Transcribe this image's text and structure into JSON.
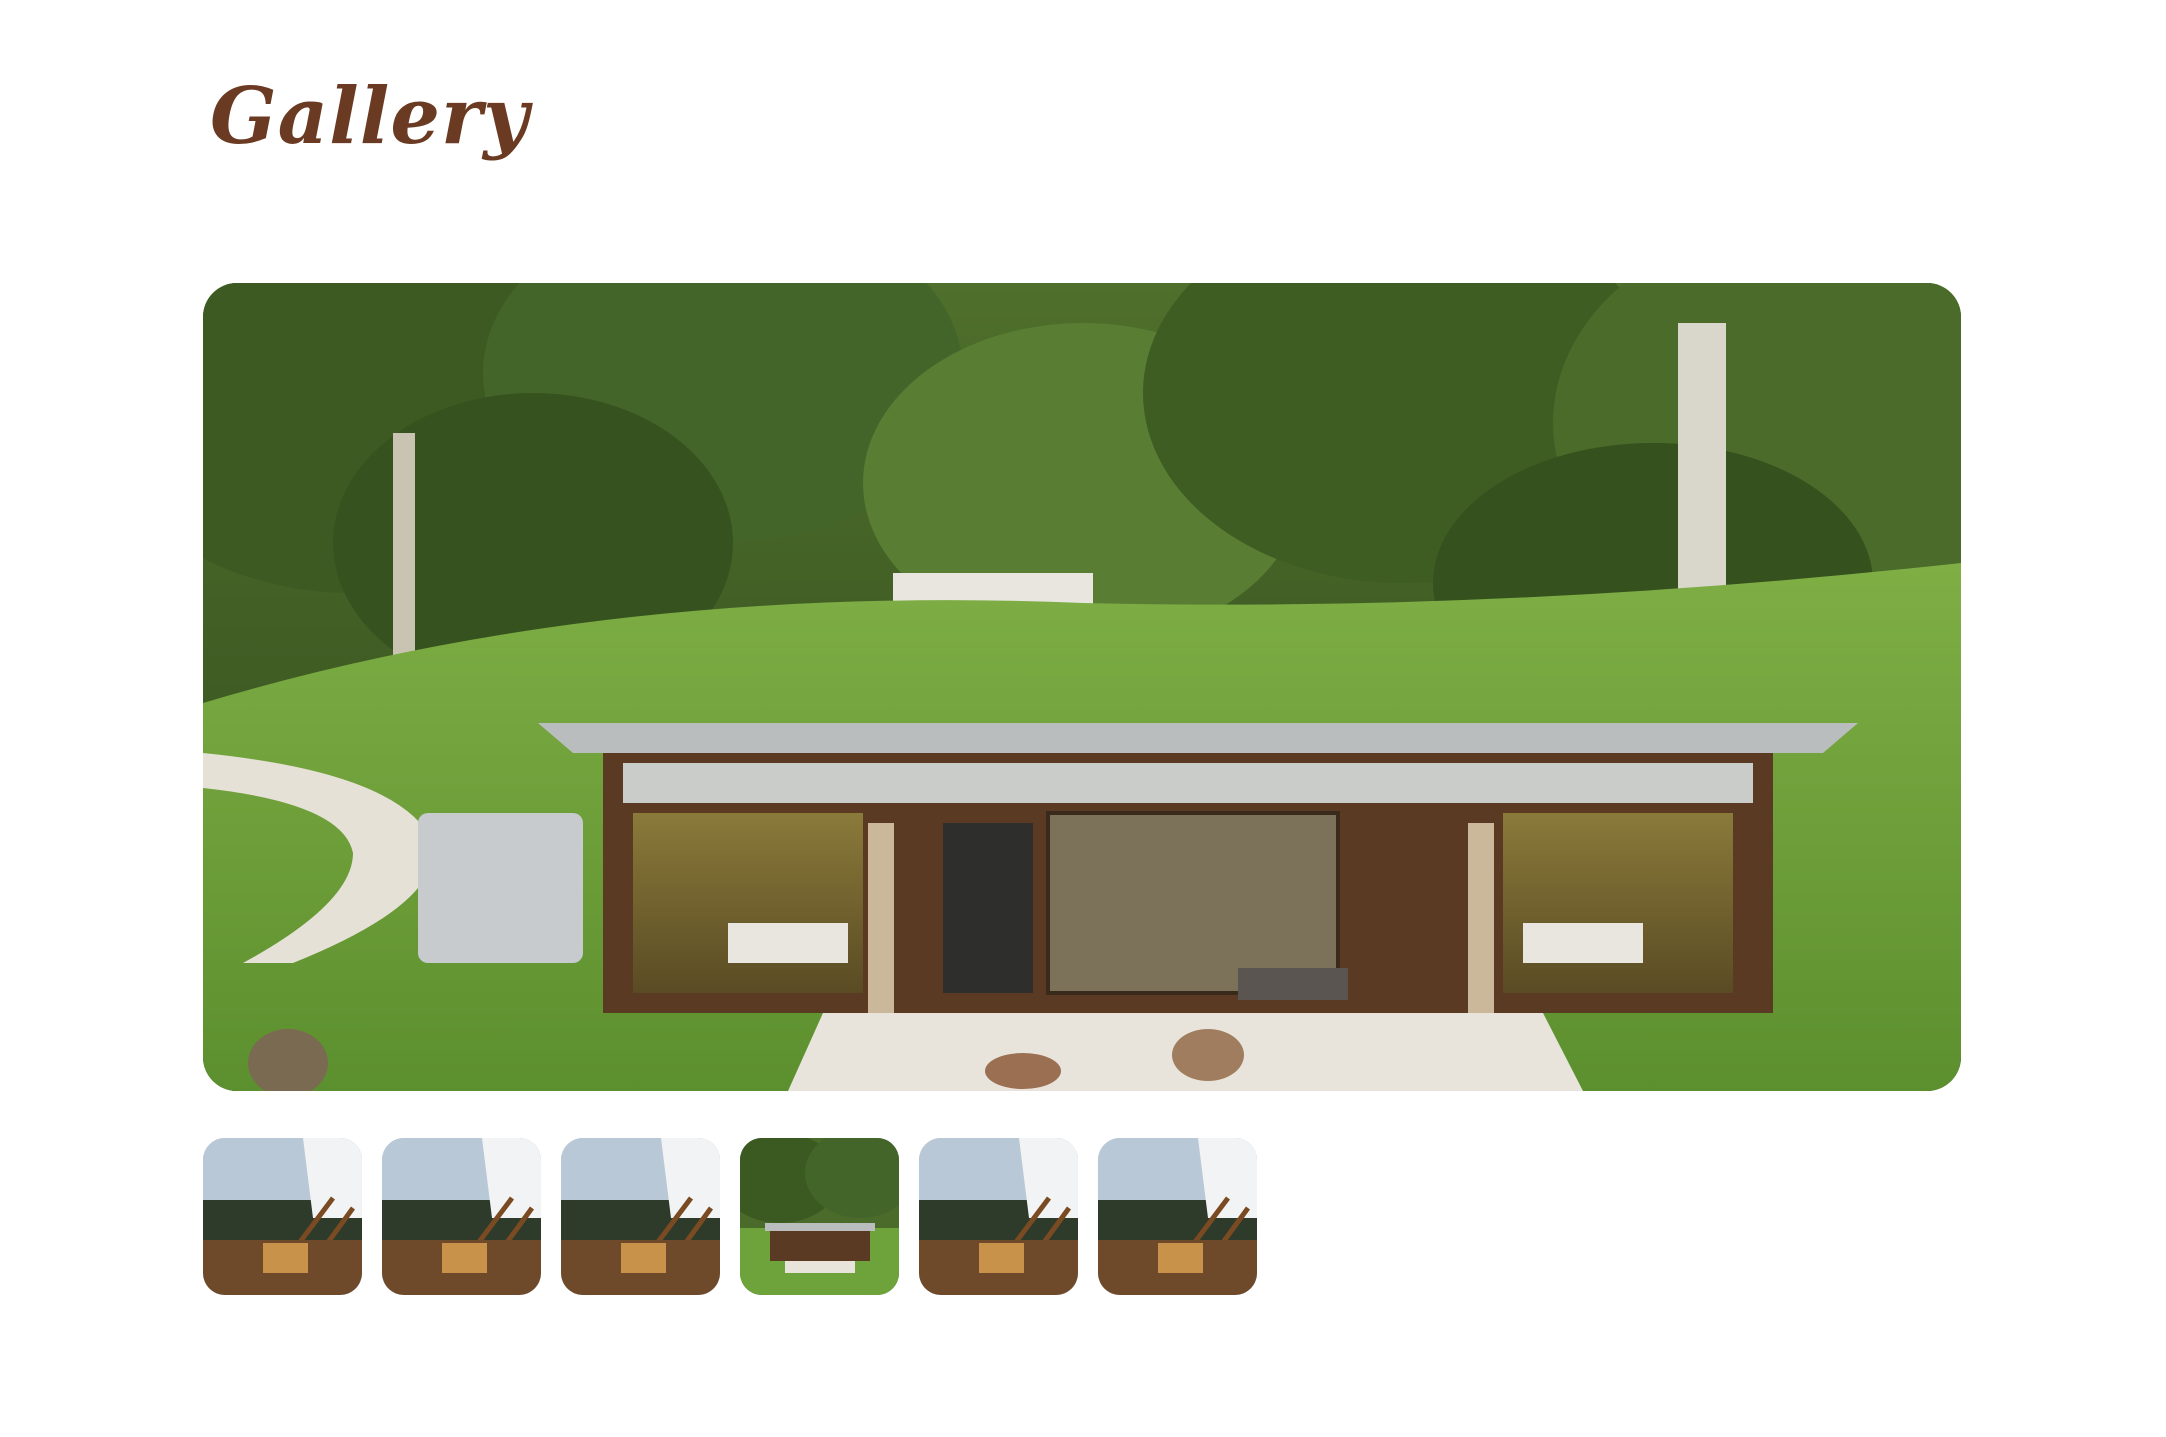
{
  "gallery": {
    "title": "Gallery"
  },
  "main_photo": {
    "subject": "house-photo",
    "selected_index": 3
  },
  "thumbnails": [
    {
      "subject": "deck-sunset-view"
    },
    {
      "subject": "deck-sunset-view"
    },
    {
      "subject": "deck-sunset-view"
    },
    {
      "subject": "house-photo"
    },
    {
      "subject": "deck-sunset-view"
    },
    {
      "subject": "deck-sunset-view"
    }
  ],
  "colors": {
    "title": "#6b3a22",
    "foliage": "#3f5e22",
    "grass": "#6ea23a",
    "roof": "#b9bdbd",
    "timber": "#6e3b1e",
    "sky": "#b9c8d6"
  }
}
